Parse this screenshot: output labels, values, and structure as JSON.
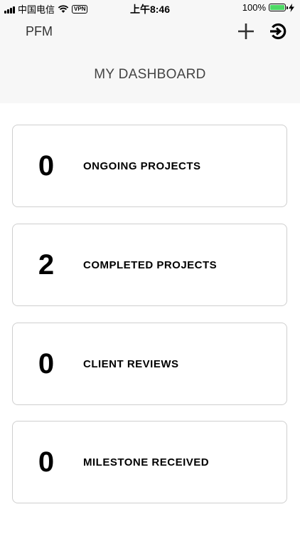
{
  "status_bar": {
    "carrier": "中国电信",
    "vpn": "VPN",
    "time": "上午8:46",
    "battery": "100%",
    "battery_level": 1.0
  },
  "header": {
    "app_title": "PFM",
    "add_icon": "plus-icon",
    "logout_icon": "logout-icon",
    "page_title": "MY DASHBOARD"
  },
  "cards": [
    {
      "value": "0",
      "label": "ONGOING PROJECTS"
    },
    {
      "value": "2",
      "label": "COMPLETED PROJECTS"
    },
    {
      "value": "0",
      "label": "CLIENT REVIEWS"
    },
    {
      "value": "0",
      "label": "MILESTONE RECEIVED"
    }
  ]
}
